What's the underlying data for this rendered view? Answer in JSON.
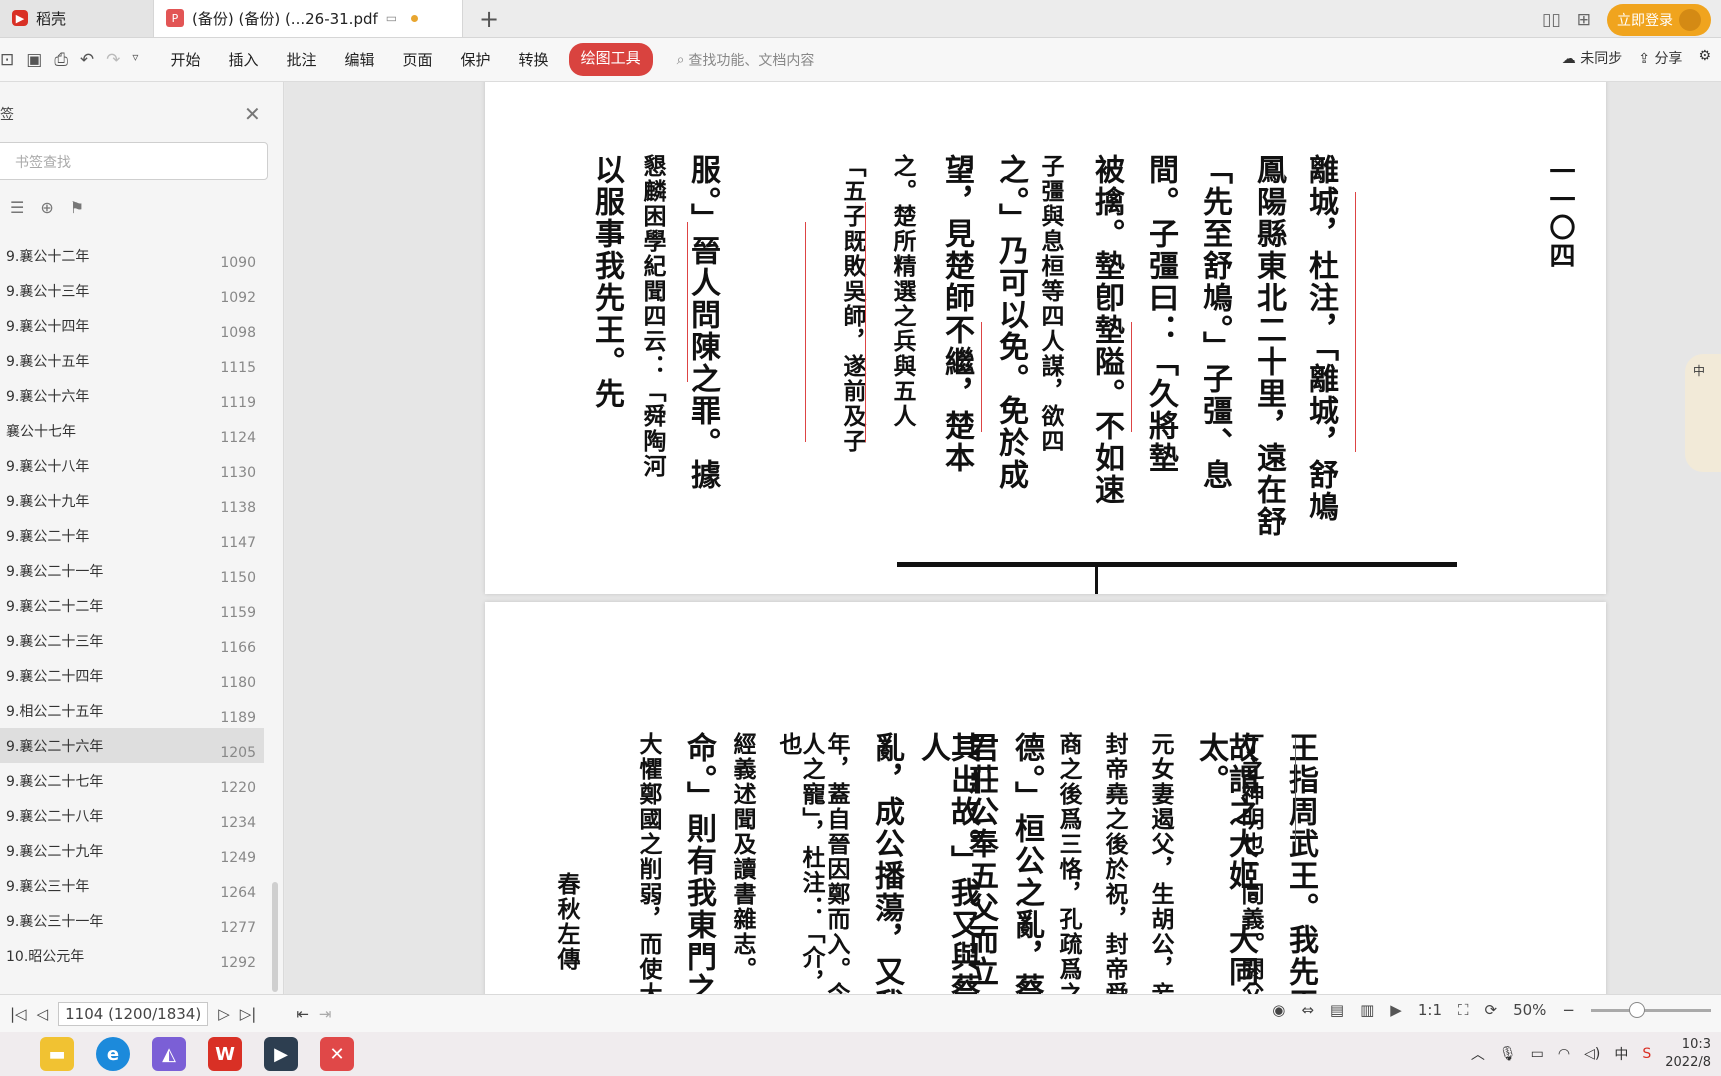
{
  "tabs": {
    "home_label": "稻壳",
    "doc_label": "(备份)  (备份)  (...26-31.pdf",
    "login_label": "立即登录"
  },
  "toolbar": {
    "menu": [
      "开始",
      "插入",
      "批注",
      "编辑",
      "页面",
      "保护",
      "转换"
    ],
    "active_tool": "绘图工具",
    "search_placeholder": "查找功能、文档内容",
    "sync_label": "未同步",
    "share_label": "分享"
  },
  "sidebar": {
    "title": "签",
    "search_placeholder": "书签查找",
    "bookmarks": [
      {
        "label": "9.襄公十二年",
        "page": "1090"
      },
      {
        "label": "9.襄公十三年",
        "page": "1092"
      },
      {
        "label": "9.襄公十四年",
        "page": "1098"
      },
      {
        "label": "9.襄公十五年",
        "page": "1115"
      },
      {
        "label": "9.襄公十六年",
        "page": "1119"
      },
      {
        "label": "襄公十七年",
        "page": "1124"
      },
      {
        "label": "9.襄公十八年",
        "page": "1130"
      },
      {
        "label": "9.襄公十九年",
        "page": "1138"
      },
      {
        "label": "9.襄公二十年",
        "page": "1147"
      },
      {
        "label": "9.襄公二十一年",
        "page": "1150"
      },
      {
        "label": "9.襄公二十二年",
        "page": "1159"
      },
      {
        "label": "9.襄公二十三年",
        "page": "1166"
      },
      {
        "label": "9.襄公二十四年",
        "page": "1180"
      },
      {
        "label": "9.相公二十五年",
        "page": "1189"
      },
      {
        "label": "9.襄公二十六年",
        "page": "1205",
        "selected": true
      },
      {
        "label": "9.襄公二十七年",
        "page": "1220"
      },
      {
        "label": "9.襄公二十八年",
        "page": "1234"
      },
      {
        "label": "9.襄公二十九年",
        "page": "1249"
      },
      {
        "label": "9.襄公三十年",
        "page": "1264"
      },
      {
        "label": "9.襄公三十一年",
        "page": "1277"
      },
      {
        "label": "10.昭公元年",
        "page": "1292"
      }
    ]
  },
  "page1": {
    "page_number": "一一〇四",
    "columns": [
      "離城，杜注，「離城，舒鳩",
      "鳳陽縣東北二十里，遠在舒",
      "「先至舒鳩。」子彊、息",
      "間。子彊曰：「久將墊",
      "被擒。墊卽墊隘。不如速",
      "子彊與息桓等四人謀，欲四",
      "之。」乃可以免。免於成",
      "望，見楚師不繼，楚本",
      "之。楚所精選之兵與五人",
      "「五子既敗吳師，遂前及子",
      "服。」晉人問陳之罪。據",
      "懇麟困學紀聞四云：「舜陶河",
      "以服事我先王。先"
    ]
  },
  "page2": {
    "footer_label": "春秋左傳",
    "columns": [
      "王指周武王。我先王",
      "丁之神明也」同義。閼父",
      "故謂之大姬。大同太。",
      "元女妻遏父，生胡公，妾",
      "封帝堯之後於祝，封帝舜",
      "商之後爲三恪，孔疏爲之",
      "德。」桓公之亂，蔡",
      "君莊公奉五父而立",
      "其出故。」我又與蔡人",
      "亂，成公播蕩，又我",
      "年，蓋自晉因鄭而入。今",
      "人之寵」，杜注：「介，因也",
      "經義述聞及讀書雜志。",
      "命。」則有我東門之",
      "大懼鄭國之削弱，而使大"
    ]
  },
  "widget": {
    "text": "中"
  },
  "status": {
    "page_indicator": "1104 (1200/1834)",
    "zoom": "50%"
  },
  "taskbar": {
    "time": "10:3",
    "date": "2022/8"
  }
}
